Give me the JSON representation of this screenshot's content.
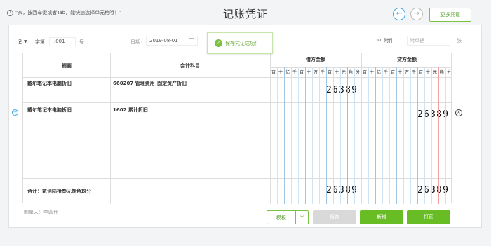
{
  "header": {
    "hint": "\"亲，按回车键或者Tab，能快速选择单元格哦！\"",
    "title": "记账凭证",
    "more_label": "更多凭证",
    "prev_glyph": "←",
    "next_glyph": "→"
  },
  "voucher": {
    "type": "记",
    "number_label": "字第",
    "number": ".001",
    "number_suffix": "号",
    "date_label": "日期:",
    "date": "2019-08-01",
    "attach_label": "附件",
    "attach_placeholder": "附单据",
    "attach_unit": "张"
  },
  "toast": {
    "text": "保存凭证成功！"
  },
  "table": {
    "col_summary": "摘要",
    "col_account": "会计科目",
    "col_debit": "借方金额",
    "col_credit": "贷方金额",
    "digit_units": [
      "百",
      "十",
      "亿",
      "千",
      "百",
      "十",
      "万",
      "千",
      "百",
      "十",
      "元",
      "角",
      "分"
    ],
    "rows": [
      {
        "summary": "戴尔笔记本电脑折旧",
        "account": "660207 管理费用_固定资产折旧",
        "debit": "26389",
        "credit": ""
      },
      {
        "summary": "戴尔笔记本电脑折旧",
        "account": "1602 累计折旧",
        "debit": "",
        "credit": "26389"
      },
      {
        "summary": "",
        "account": "",
        "debit": "",
        "credit": ""
      },
      {
        "summary": "",
        "account": "",
        "debit": "",
        "credit": ""
      }
    ],
    "total_label": "合计：贰佰陆拾叁元捌角玖分",
    "total_debit": "26389",
    "total_credit": "26389"
  },
  "footer": {
    "maker": "制单人：李四代",
    "template_label": "模板",
    "save_label": "保存",
    "new_label": "新增",
    "print_label": "打印"
  },
  "colors": {
    "accent": "#68bd24",
    "blue": "#3aa3e3",
    "red_line": "#f2a0a0"
  }
}
